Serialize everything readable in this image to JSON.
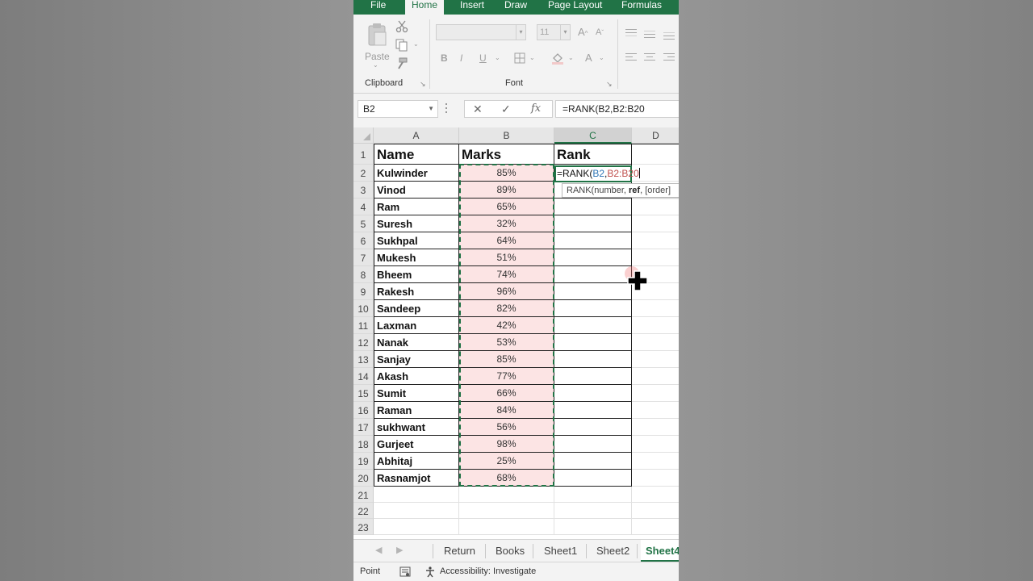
{
  "ribbon": {
    "tabs": [
      {
        "label": "File",
        "active": false
      },
      {
        "label": "Home",
        "active": true
      },
      {
        "label": "Insert",
        "active": false
      },
      {
        "label": "Draw",
        "active": false
      },
      {
        "label": "Page Layout",
        "active": false
      },
      {
        "label": "Formulas",
        "active": false
      }
    ],
    "clipboard": {
      "paste_label": "Paste",
      "group_label": "Clipboard"
    },
    "font": {
      "group_label": "Font",
      "font_size": "11",
      "bold": "B",
      "italic": "I",
      "underline": "U",
      "font_color_letter": "A"
    }
  },
  "formula_bar": {
    "name_box": "B2",
    "formula": "=RANK(B2,B2:B20"
  },
  "grid": {
    "columns": [
      "A",
      "B",
      "C",
      "D"
    ],
    "headers": {
      "name": "Name",
      "marks": "Marks",
      "rank": "Rank"
    },
    "rows": [
      {
        "num": "1"
      },
      {
        "num": "2",
        "name": "Kulwinder",
        "marks": "85%"
      },
      {
        "num": "3",
        "name": "Vinod",
        "marks": "89%"
      },
      {
        "num": "4",
        "name": "Ram",
        "marks": "65%"
      },
      {
        "num": "5",
        "name": "Suresh",
        "marks": "32%"
      },
      {
        "num": "6",
        "name": "Sukhpal",
        "marks": "64%"
      },
      {
        "num": "7",
        "name": "Mukesh",
        "marks": "51%"
      },
      {
        "num": "8",
        "name": "Bheem",
        "marks": "74%"
      },
      {
        "num": "9",
        "name": "Rakesh",
        "marks": "96%"
      },
      {
        "num": "10",
        "name": "Sandeep",
        "marks": "82%"
      },
      {
        "num": "11",
        "name": "Laxman",
        "marks": "42%"
      },
      {
        "num": "12",
        "name": "Nanak",
        "marks": "53%"
      },
      {
        "num": "13",
        "name": "Sanjay",
        "marks": "85%"
      },
      {
        "num": "14",
        "name": "Akash",
        "marks": "77%"
      },
      {
        "num": "15",
        "name": "Sumit",
        "marks": "66%"
      },
      {
        "num": "16",
        "name": "Raman",
        "marks": "84%"
      },
      {
        "num": "17",
        "name": "sukhwant",
        "marks": "56%"
      },
      {
        "num": "18",
        "name": "Gurjeet",
        "marks": "98%"
      },
      {
        "num": "19",
        "name": "Abhitaj",
        "marks": "25%"
      },
      {
        "num": "20",
        "name": "Rasnamjot",
        "marks": "68%"
      },
      {
        "num": "21"
      },
      {
        "num": "22"
      },
      {
        "num": "23"
      }
    ],
    "editing_cell": {
      "prefix": "=RANK(",
      "arg1": "B2",
      "sep": ",",
      "arg2": "B2:B20",
      "arg1_color": "#2f75b5",
      "arg2_color": "#c0504d"
    },
    "tooltip": {
      "func": "RANK(number, ",
      "bold_arg": "ref",
      "rest": ", [order]"
    }
  },
  "sheets": [
    {
      "label": "Return",
      "active": false
    },
    {
      "label": "Books",
      "active": false
    },
    {
      "label": "Sheet1",
      "active": false
    },
    {
      "label": "Sheet2",
      "active": false
    },
    {
      "label": "Sheet4",
      "active": true
    }
  ],
  "status": {
    "mode": "Point",
    "accessibility": "Accessibility: Investigate"
  },
  "colors": {
    "excel_green": "#217346",
    "marks_fill": "#fce4e4"
  }
}
